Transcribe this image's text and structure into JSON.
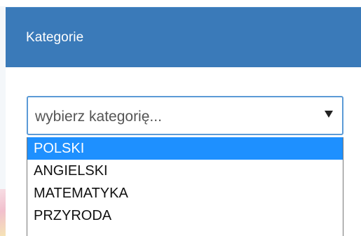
{
  "panel": {
    "title": "Kategorie"
  },
  "select": {
    "placeholder": "wybierz kategorię...",
    "options": [
      "POLSKI",
      "ANGIELSKI",
      "MATEMATYKA",
      "PRZYRODA"
    ],
    "highlighted_index": 0
  },
  "colors": {
    "header_bg": "#3a7ab9",
    "select_border": "#5b9ad6",
    "option_highlight": "#1e90ff"
  },
  "icons": {
    "dropdown_arrow": "caret-down-icon"
  }
}
